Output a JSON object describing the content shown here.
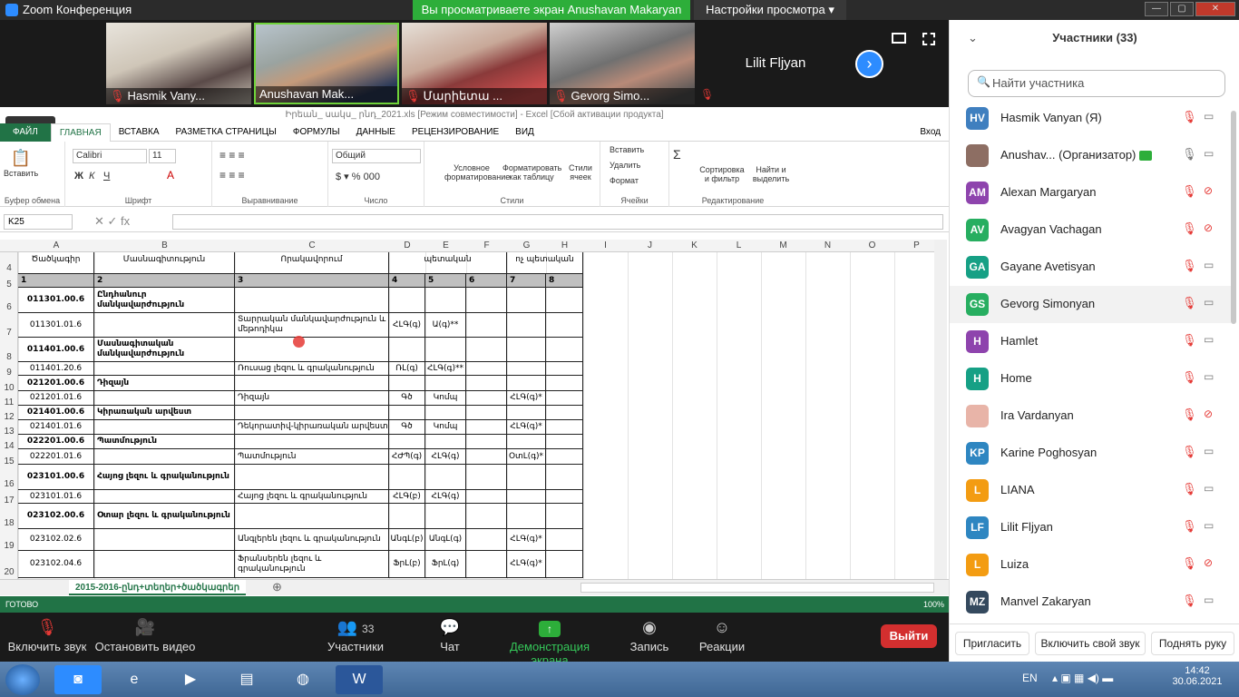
{
  "zoom": {
    "title": "Zoom Конференция",
    "banner": "Вы просматриваете экран Anushavan Makaryan",
    "view_settings": "Настройки просмотра",
    "tiles": [
      {
        "name": "Hasmik Vany..."
      },
      {
        "name": "Anushavan Mak..."
      },
      {
        "name": "Մարիետա ..."
      },
      {
        "name": "Gevorg Simo..."
      }
    ],
    "speaker_name": "Lilit Fljyan",
    "toolbar": {
      "unmute": "Включить звук",
      "start_video": "Остановить видео",
      "participants": "Участники",
      "participants_count": "33",
      "chat": "Чат",
      "share": "Демонстрация экрана",
      "record": "Запись",
      "reactions": "Реакции",
      "leave": "Выйти"
    }
  },
  "excel": {
    "title": "Իրեան_ սակս_ րնդ_2021.xls  [Режим совместимости] - Excel [Сбой активации продукта]",
    "tabs": [
      "ФАЙЛ",
      "ГЛАВНАЯ",
      "ВСТАВКА",
      "РАЗМЕТКА СТРАНИЦЫ",
      "ФОРМУЛЫ",
      "ДАННЫЕ",
      "РЕЦЕНЗИРОВАНИЕ",
      "ВИД"
    ],
    "signin": "Вход",
    "ribbon": {
      "paste": "Вставить",
      "clipboard": "Буфер обмена",
      "font_name": "Calibri",
      "font_size": "11",
      "font": "Шрифт",
      "alignment": "Выравнивание",
      "number_format": "Общий",
      "number": "Число",
      "cond_format": "Условное форматирование",
      "format_table": "Форматировать как таблицу",
      "cell_styles": "Стили ячеек",
      "styles": "Стили",
      "insert": "Вставить",
      "delete": "Удалить",
      "format": "Формат",
      "cells": "Ячейки",
      "sort_filter": "Сортировка и фильтр",
      "find_select": "Найти и выделить",
      "editing": "Редактирование"
    },
    "name_box": "K25",
    "columns": [
      "A",
      "B",
      "C",
      "D",
      "E",
      "F",
      "G",
      "H",
      "I",
      "J",
      "K",
      "L",
      "M",
      "N",
      "O",
      "P"
    ],
    "row_numbers": [
      "4",
      "5",
      "6",
      "7",
      "8",
      "9",
      "10",
      "11",
      "12",
      "13",
      "14",
      "15",
      "16",
      "17",
      "18",
      "19",
      "20"
    ],
    "top_partial": {
      "a": "Ծածկագիր",
      "b": "Մասնագիտություն",
      "c": "Որակավորում",
      "de": "պետական",
      "gh": "ոչ պետական"
    },
    "header_row": [
      "1",
      "2",
      "3",
      "4",
      "5",
      "6",
      "7",
      "8"
    ],
    "rows": [
      {
        "a": "011301.00.6",
        "b": "Ընդհանուր մանկավարժություն",
        "c": "",
        "d": "",
        "e": "",
        "g": "",
        "bold": true
      },
      {
        "a": "011301.01.6",
        "b": "",
        "c": "Տարրական մանկավարժություն և մեթոդիկա",
        "d": "ՀԼԳ(գ)",
        "e": "Ա(գ)**",
        "g": "",
        "bold": false
      },
      {
        "a": "011401.00.6",
        "b": "Մասնագիտական մանկավարժություն",
        "c": "",
        "d": "",
        "e": "",
        "g": "",
        "bold": true
      },
      {
        "a": "011401.20.6",
        "b": "",
        "c": "Ռուսաց լեզու և գրականություն",
        "d": "ՌԼ(գ)",
        "e": "ՀԼԳ(գ)**",
        "g": "",
        "bold": false
      },
      {
        "a": "021201.00.6",
        "b": "Դիզայն",
        "c": "",
        "d": "",
        "e": "",
        "g": "",
        "bold": true
      },
      {
        "a": "021201.01.6",
        "b": "",
        "c": "Դիզայն",
        "d": "Գծ",
        "e": "Կոմպ",
        "g": "ՀԼԳ(գ)*",
        "bold": false
      },
      {
        "a": "021401.00.6",
        "b": "Կիրառական արվեստ",
        "c": "",
        "d": "",
        "e": "",
        "g": "",
        "bold": true
      },
      {
        "a": "021401.01.6",
        "b": "",
        "c": "Դեկորատիվ-կիրառական արվեստ",
        "d": "Գծ",
        "e": "Կոմպ",
        "g": "ՀԼԳ(գ)*",
        "bold": false
      },
      {
        "a": "022201.00.6",
        "b": "Պատմություն",
        "c": "",
        "d": "",
        "e": "",
        "g": "",
        "bold": true
      },
      {
        "a": "022201.01.6",
        "b": "",
        "c": "Պատմություն",
        "d": "ՀԺՊ(գ)",
        "e": "ՀԼԳ(գ)",
        "g": "ՕտԼ(գ)*",
        "bold": false
      },
      {
        "a": "023101.00.6",
        "b": "Հայոց լեզու և գրականություն",
        "c": "",
        "d": "",
        "e": "",
        "g": "",
        "bold": true
      },
      {
        "a": "023101.01.6",
        "b": "",
        "c": "Հայոց լեզու և գրականություն",
        "d": "ՀԼԳ(բ)",
        "e": "ՀԼԳ(գ)",
        "g": "",
        "bold": false
      },
      {
        "a": "023102.00.6",
        "b": "Օտար լեզու և գրականություն",
        "c": "",
        "d": "",
        "e": "",
        "g": "",
        "bold": true
      },
      {
        "a": "023102.02.6",
        "b": "",
        "c": "Անգլերեն լեզու և գրականություն",
        "d": "ԱնգԼ(բ)",
        "e": "ԱնգԼ(գ)",
        "g": "ՀԼԳ(գ)*",
        "bold": false
      },
      {
        "a": "023102.04.6",
        "b": "",
        "c": "Ֆրանսերեն լեզու և գրականություն",
        "d": "ՖրԼ(բ)",
        "e": "ՖրԼ(գ)",
        "g": "ՀԼԳ(գ)*",
        "bold": false
      }
    ],
    "sheet_tab": "2015-2016-ընդ+տեղեր+ծածկագրեր",
    "status": "ГОТОВО",
    "zoom_level": "100%"
  },
  "participants": {
    "title": "Участники (33)",
    "search_placeholder": "Найти участника",
    "list": [
      {
        "initials": "HV",
        "name": "Hasmik Vanyan (Я)",
        "color": "#3f7fbf",
        "cam": "on"
      },
      {
        "initials": "",
        "name": "Anushav... (Организатор)",
        "color": "#8d6e63",
        "cam": "on",
        "host": true
      },
      {
        "initials": "AM",
        "name": "Alexan Margaryan",
        "color": "#8e44ad",
        "cam": "off"
      },
      {
        "initials": "AV",
        "name": "Avagyan Vachagan",
        "color": "#27ae60",
        "cam": "off"
      },
      {
        "initials": "GA",
        "name": "Gayane Avetisyan",
        "color": "#16a085",
        "cam": "on"
      },
      {
        "initials": "GS",
        "name": "Gevorg Simonyan",
        "color": "#27ae60",
        "cam": "on"
      },
      {
        "initials": "H",
        "name": "Hamlet",
        "color": "#8e44ad",
        "cam": "on"
      },
      {
        "initials": "H",
        "name": "Home",
        "color": "#16a085",
        "cam": "on"
      },
      {
        "initials": "",
        "name": "Ira Vardanyan",
        "color": "#e8b4a8",
        "cam": "off"
      },
      {
        "initials": "KP",
        "name": "Karine Poghosyan",
        "color": "#2e86c1",
        "cam": "on"
      },
      {
        "initials": "L",
        "name": "LIANA",
        "color": "#f39c12",
        "cam": "on"
      },
      {
        "initials": "LF",
        "name": "Lilit Fljyan",
        "color": "#2e86c1",
        "cam": "on"
      },
      {
        "initials": "L",
        "name": "Luiza",
        "color": "#f39c12",
        "cam": "off"
      },
      {
        "initials": "MZ",
        "name": "Manvel Zakaryan",
        "color": "#34495e",
        "cam": "on"
      }
    ],
    "invite": "Пригласить",
    "unmute_me": "Включить свой звук",
    "raise_hand": "Поднять руку"
  },
  "taskbar": {
    "lang": "EN",
    "time": "14:42",
    "date": "30.06.2021"
  }
}
